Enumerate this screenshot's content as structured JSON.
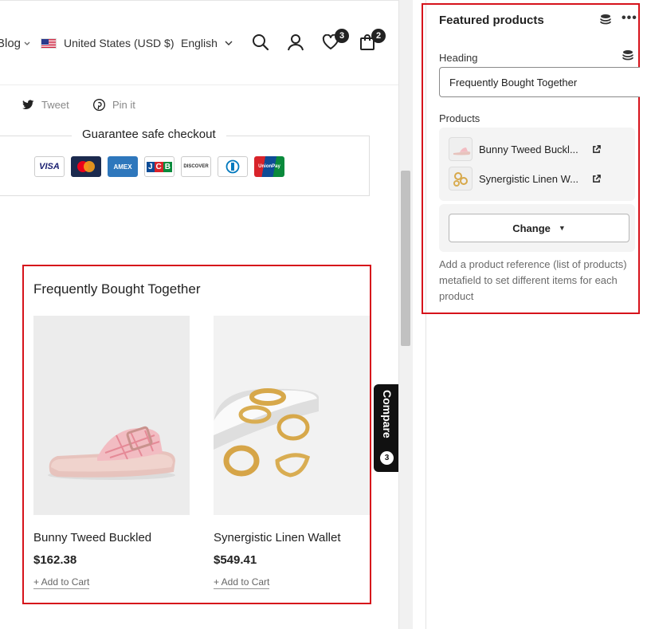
{
  "header": {
    "blog_label": "Blog",
    "currency_label": "United States (USD $)",
    "language_label": "English",
    "wishlist_count": "3",
    "cart_count": "2",
    "icons": [
      "search-icon",
      "account-icon",
      "heart-icon",
      "bag-icon"
    ]
  },
  "share": {
    "tweet_label": "Tweet",
    "pin_label": "Pin it"
  },
  "checkout": {
    "title": "Guarantee safe checkout",
    "payment_methods": [
      "VISA",
      "mastercard",
      "AMEX",
      "JCB",
      "DISCOVER",
      "Diners Club",
      "UnionPay"
    ]
  },
  "featured_section": {
    "heading": "Frequently Bought Together",
    "products": [
      {
        "title": "Bunny Tweed Buckled",
        "price": "$162.38",
        "add_label": "+ Add to Cart"
      },
      {
        "title": "Synergistic Linen Wallet",
        "price": "$549.41",
        "add_label": "+ Add to Cart"
      }
    ]
  },
  "compare": {
    "label": "Compare",
    "count": "3"
  },
  "editor": {
    "title": "Featured products",
    "more_label": "•••",
    "heading_label": "Heading",
    "heading_value": "Frequently Bought Together",
    "products_label": "Products",
    "products": [
      {
        "name": "Bunny Tweed Buckl..."
      },
      {
        "name": "Synergistic Linen W..."
      }
    ],
    "change_label": "Change",
    "help_text": "Add a product reference (list of products) metafield to set different items for each product"
  },
  "colors": {
    "highlight_border": "#d6131b",
    "badge_bg": "#222222",
    "compare_bg": "#111111"
  }
}
